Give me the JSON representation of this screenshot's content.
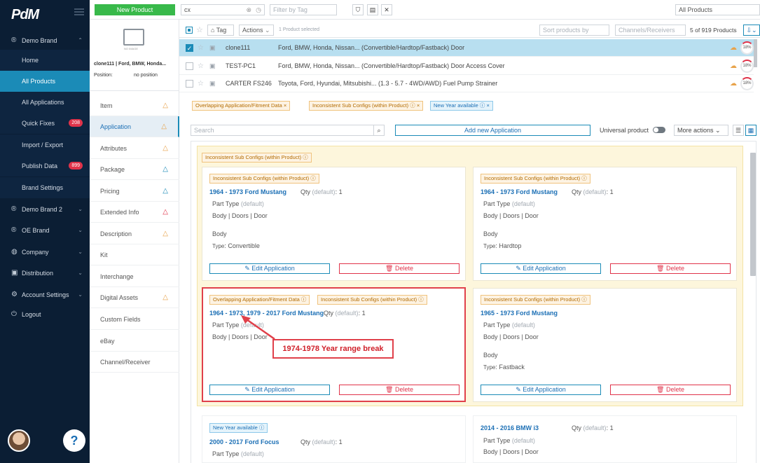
{
  "sidebar": {
    "logo": "PdM",
    "items": [
      {
        "label": "Demo Brand",
        "icon": "brand-icon",
        "chev": "⌃"
      },
      {
        "label": "Home"
      },
      {
        "label": "All Products"
      },
      {
        "label": "All Applications"
      },
      {
        "label": "Quick Fixes",
        "badge": "208"
      },
      {
        "label": "Import / Export"
      },
      {
        "label": "Publish Data",
        "badge": "899"
      },
      {
        "label": "Brand Settings"
      },
      {
        "label": "Demo Brand 2",
        "chev": "⌄"
      },
      {
        "label": "OE Brand",
        "chev": "⌄"
      },
      {
        "label": "Company",
        "chev": "⌄"
      },
      {
        "label": "Distribution",
        "chev": "⌄"
      },
      {
        "label": "Account Settings",
        "chev": "⌄"
      },
      {
        "label": "Logout"
      }
    ],
    "help": "?"
  },
  "topbar": {
    "new_product": "New Product",
    "search_value": "cx",
    "filter_placeholder": "Filter by Tag",
    "scope": "All Products"
  },
  "list_toolbar": {
    "tag": "Tag",
    "actions": "Actions",
    "selected": "1 Product selected",
    "sort_placeholder": "Sort products by",
    "channels_placeholder": "Channels/Receivers",
    "count": "5 of 919 Products"
  },
  "product_summary": {
    "no_image": "NO IMAGE",
    "title": "clone111 | Ford, BMW, Honda...",
    "position_label": "Position:",
    "position_value": "no position"
  },
  "products": [
    {
      "name": "clone111",
      "desc": "Ford, BMW, Honda, Nissan... (Convertible/Hardtop/Fastback) Door",
      "pct": "18%"
    },
    {
      "name": "TEST-PC1",
      "desc": "Ford, BMW, Honda, Nissan... (Convertible/Hardtop/Fastback) Door Access Cover",
      "pct": "18%"
    },
    {
      "name": "CARTER FS246",
      "desc": "Toyota, Ford, Hyundai, Mitsubishi... (1.3 - 5.7 - 4WD/AWD) Fuel Pump Strainer",
      "pct": "18%"
    }
  ],
  "detail_menu": [
    "Item",
    "Application",
    "Attributes",
    "Package",
    "Pricing",
    "Extended Info",
    "Description",
    "Kit",
    "Interchange",
    "Digital Assets",
    "Custom Fields",
    "eBay",
    "Channel/Receiver"
  ],
  "chips": [
    "Overlapping Application/Fitment Data",
    "Inconsistent Sub Configs (within Product)",
    "New Year available"
  ],
  "app_toolbar": {
    "search_placeholder": "Search",
    "add_new": "Add new Application",
    "universal": "Universal product",
    "more_actions": "More actions"
  },
  "group_tag": "Inconsistent Sub Configs (within Product)",
  "labels": {
    "qty": "Qty",
    "default": "(default)",
    "qty_val": ": 1",
    "part_type": "Part Type",
    "part_value": "Body | Doors | Door",
    "body": "Body",
    "type": "Type",
    "edit": "Edit Application",
    "delete": "Delete"
  },
  "cards": [
    {
      "tags": [
        "Inconsistent Sub Configs (within Product)"
      ],
      "title": "1964 - 1973 Ford Mustang",
      "type": ": Convertible"
    },
    {
      "tags": [
        "Inconsistent Sub Configs (within Product)"
      ],
      "title": "1964 - 1973 Ford Mustang",
      "type": ": Hardtop"
    },
    {
      "tags": [
        "Overlapping Application/Fitment Data",
        "Inconsistent Sub Configs (within Product)"
      ],
      "title": "1964 - 1973, 1979 - 2017 Ford Mustang"
    },
    {
      "tags": [
        "Inconsistent Sub Configs (within Product)"
      ],
      "title": "1965 - 1973 Ford Mustang",
      "type": ": Fastback"
    },
    {
      "tags": [
        "New Year available"
      ],
      "title": "2000 - 2017 Ford Focus"
    },
    {
      "title": "2014 - 2016 BMW i3"
    }
  ],
  "annotation": "1974-1978 Year range break",
  "colors": {
    "sidebar": "#0b1e34",
    "accent": "#1b8bb7",
    "new_button": "#38b94a",
    "warning": "#e8a34b",
    "error": "#e0334a",
    "highlight": "#e0404a"
  }
}
